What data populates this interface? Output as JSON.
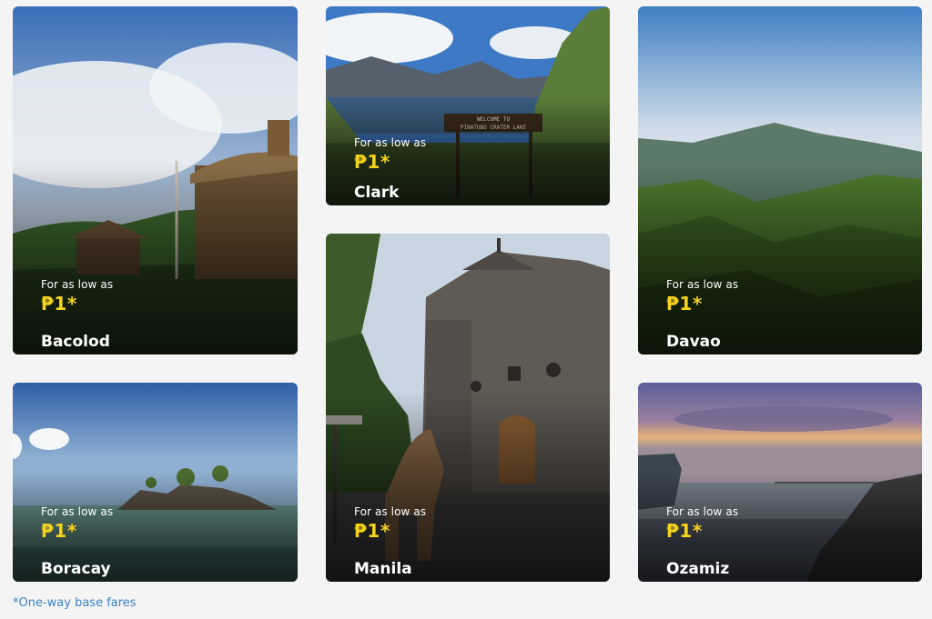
{
  "common": {
    "for_as_low_as": "For as low as",
    "price": "₱1*"
  },
  "destinations": {
    "bacolod": {
      "name": "Bacolod"
    },
    "clark": {
      "name": "Clark"
    },
    "davao": {
      "name": "Davao"
    },
    "boracay": {
      "name": "Boracay"
    },
    "manila": {
      "name": "Manila"
    },
    "ozamiz": {
      "name": "Ozamiz"
    }
  },
  "footnote": "*One-way base fares",
  "colors": {
    "price_accent": "#f5d21c",
    "footnote_link": "#3b82c8",
    "page_background": "#f4f4f4"
  }
}
